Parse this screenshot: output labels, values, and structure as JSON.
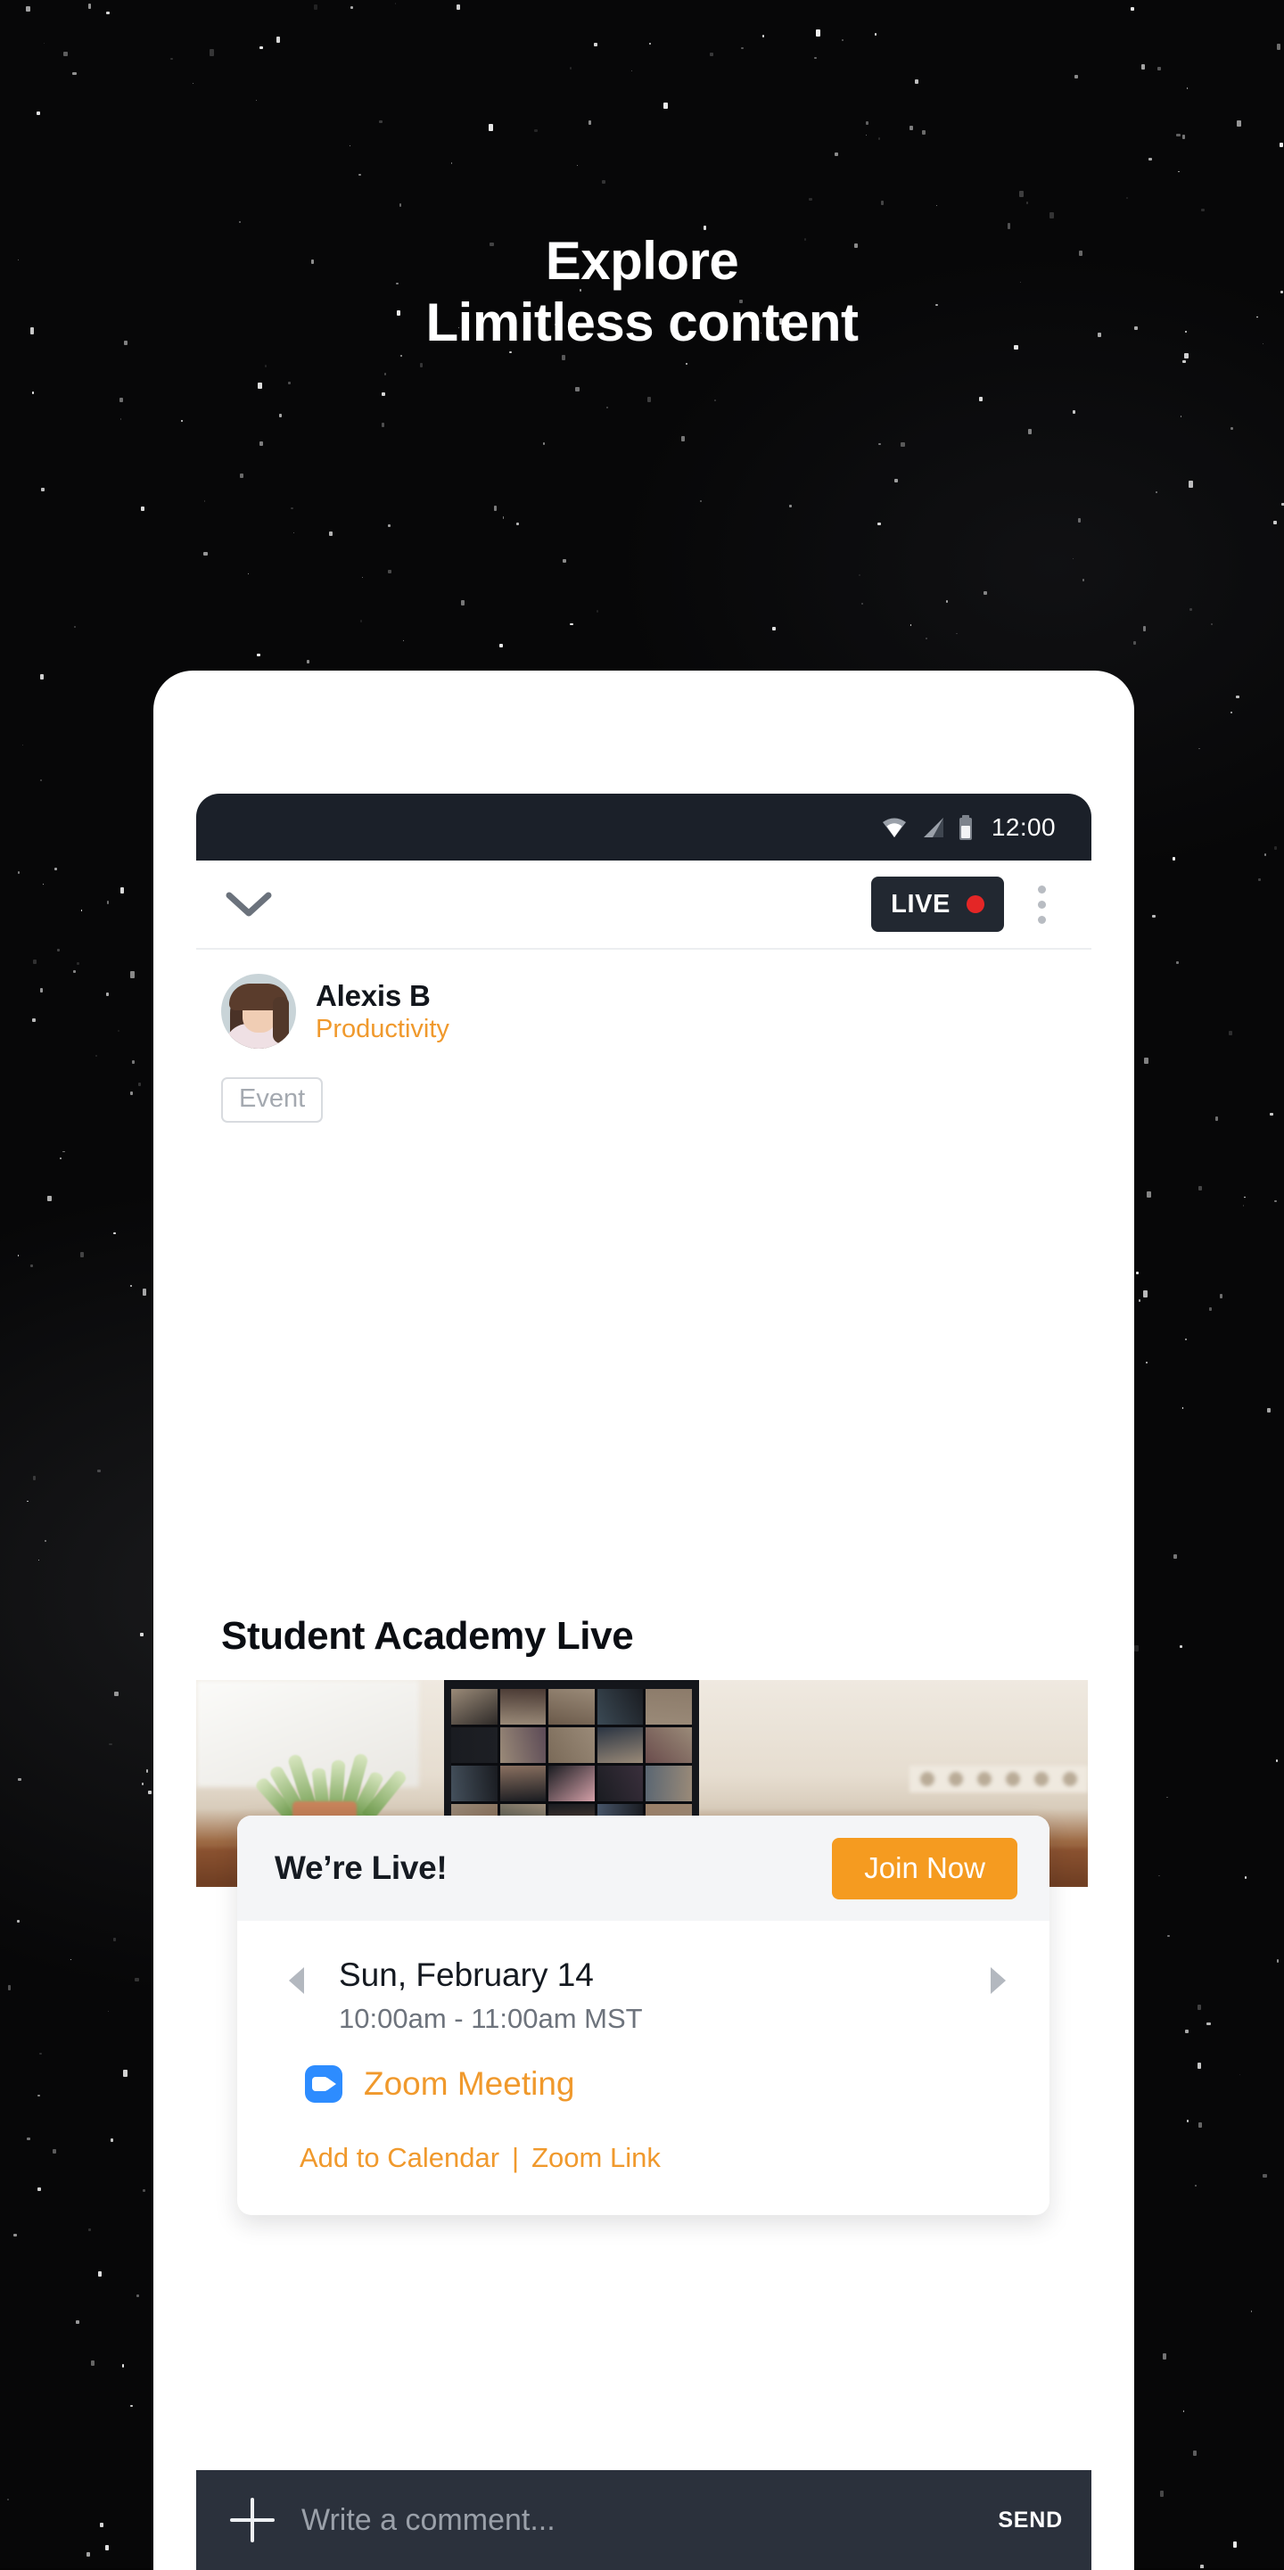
{
  "hero": {
    "line1": "Explore",
    "line2": "Limitless content",
    "text_color": "#ffffff",
    "background_color": "#070708"
  },
  "phone": {
    "status_bar": {
      "time": "12:00",
      "icons": [
        "wifi-icon",
        "cellular-signal-icon",
        "battery-icon"
      ],
      "background_color": "#1b2029"
    },
    "header": {
      "collapse_icon": "chevron-down-icon",
      "live_badge_label": "LIVE",
      "live_dot_color": "#e42626",
      "live_badge_color": "#222831",
      "overflow_icon": "more-vertical-icon"
    },
    "author": {
      "name": "Alexis B",
      "category": "Productivity",
      "category_color": "#f0992c",
      "tag": "Event"
    },
    "post": {
      "title": "Student Academy Live",
      "media_alt": "laptop-showing-zoom-meeting-grid"
    },
    "event_card": {
      "live_banner_title": "We’re Live!",
      "join_button_label": "Join Now",
      "join_button_color": "#f59b20",
      "prev_icon": "triangle-left-icon",
      "next_icon": "triangle-right-icon",
      "date": "Sun, February 14",
      "time": "10:00am - 11:00am MST",
      "meeting_icon": "zoom-icon",
      "meeting_label": "Zoom Meeting",
      "meeting_label_color": "#f0992c",
      "link_calendar": "Add to Calendar",
      "link_separator": "|",
      "link_zoom": "Zoom Link"
    },
    "comment_bar": {
      "add_icon": "plus-icon",
      "input_placeholder": "Write a comment...",
      "input_value": "",
      "send_label": "SEND",
      "background_color": "#2b313c"
    }
  }
}
